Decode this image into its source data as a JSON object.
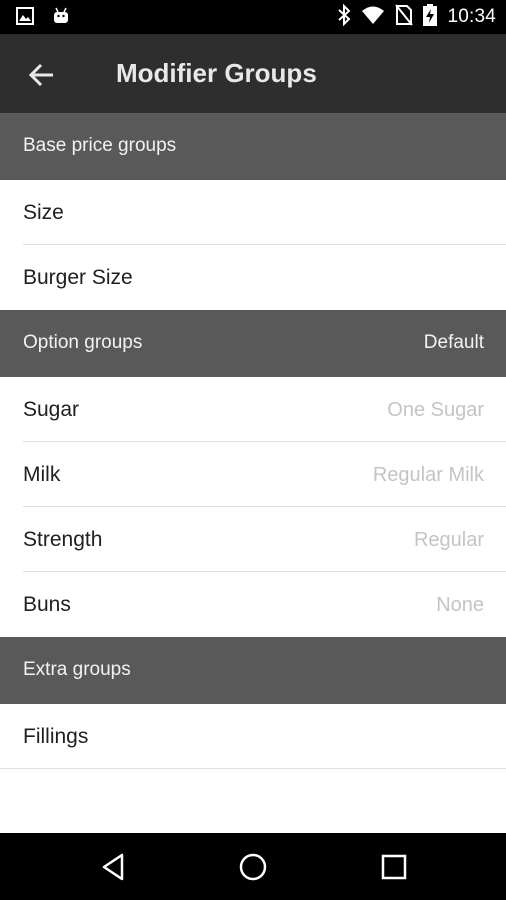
{
  "status_bar": {
    "time": "10:34",
    "icons_left": [
      "image-icon",
      "android-icon"
    ],
    "icons_right": [
      "bluetooth-icon",
      "wifi-icon",
      "no-sim-icon",
      "battery-charging-icon"
    ]
  },
  "app_bar": {
    "title": "Modifier Groups",
    "back_icon": "arrow-back-icon"
  },
  "sections": {
    "base": {
      "title": "Base price groups",
      "items": [
        {
          "label": "Size",
          "value": ""
        },
        {
          "label": "Burger Size",
          "value": ""
        }
      ]
    },
    "option": {
      "title": "Option groups",
      "right_label": "Default",
      "items": [
        {
          "label": "Sugar",
          "value": "One Sugar"
        },
        {
          "label": "Milk",
          "value": "Regular Milk"
        },
        {
          "label": "Strength",
          "value": "Regular"
        },
        {
          "label": "Buns",
          "value": "None"
        }
      ]
    },
    "extra": {
      "title": "Extra groups",
      "items": [
        {
          "label": "Fillings",
          "value": ""
        }
      ]
    }
  },
  "nav_bar": {
    "icons": [
      "back-triangle-icon",
      "home-circle-icon",
      "recents-square-icon"
    ]
  },
  "colors": {
    "app_bar": "#2e2e2e",
    "section_header": "#595959",
    "value_text": "#c4c4c4"
  }
}
